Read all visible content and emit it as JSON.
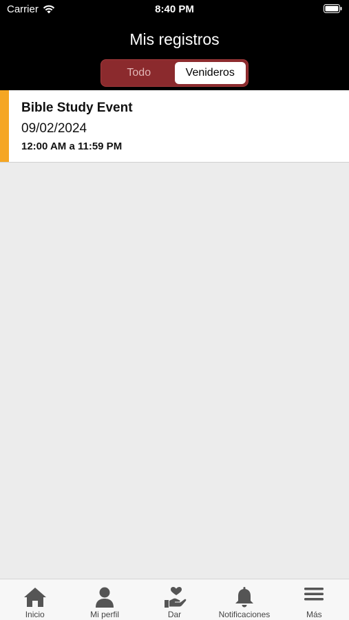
{
  "status_bar": {
    "carrier": "Carrier",
    "time": "8:40 PM"
  },
  "nav": {
    "title": "Mis registros"
  },
  "segmented": {
    "options": [
      "Todo",
      "Venideros"
    ],
    "selected": "Venideros"
  },
  "events": [
    {
      "title": "Bible Study Event",
      "date": "09/02/2024",
      "time": "12:00 AM a 11:59 PM",
      "accent": "#f5a623"
    }
  ],
  "tabs": [
    {
      "label": "Inicio",
      "icon": "home-icon"
    },
    {
      "label": "Mi perfil",
      "icon": "person-icon"
    },
    {
      "label": "Dar",
      "icon": "give-icon"
    },
    {
      "label": "Notificaciones",
      "icon": "bell-icon"
    },
    {
      "label": "Más",
      "icon": "menu-icon"
    }
  ],
  "colors": {
    "header_bg": "#000000",
    "segment_bg": "#8b2a2d",
    "content_bg": "#ececec",
    "event_accent": "#f5a623"
  }
}
